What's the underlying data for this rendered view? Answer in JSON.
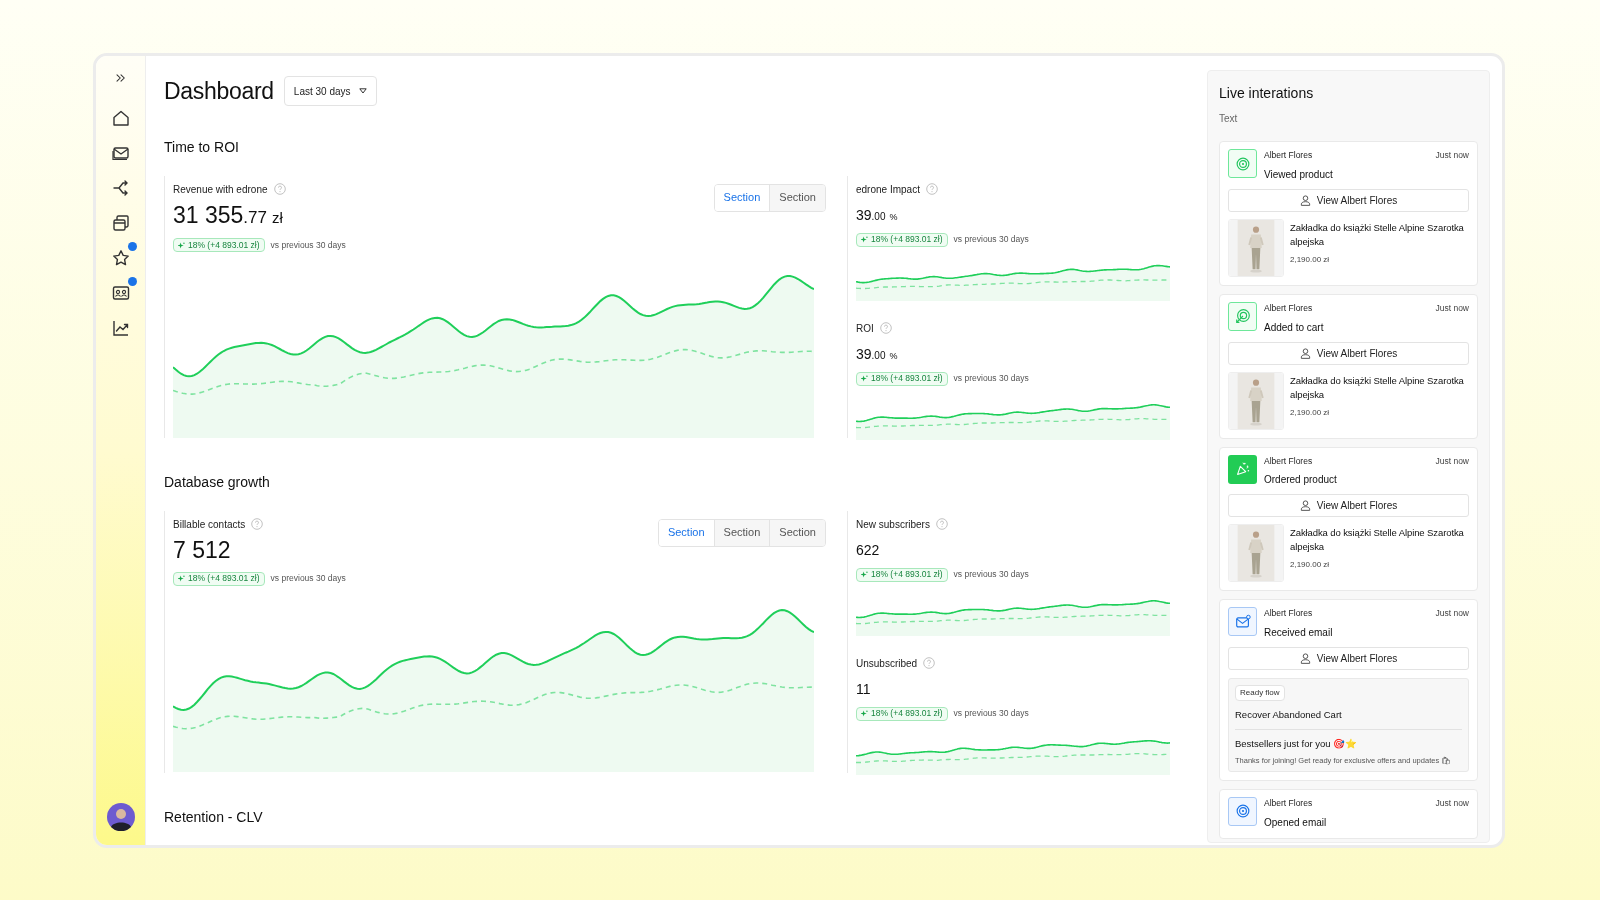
{
  "sidebar": {
    "items": [
      {
        "notification": false
      },
      {
        "notification": false
      },
      {
        "notification": false
      },
      {
        "notification": true
      },
      {
        "notification": true
      },
      {
        "notification": false
      }
    ]
  },
  "header": {
    "title": "Dashboard",
    "period": "Last 30 days"
  },
  "sections": [
    {
      "title": "Time to ROI",
      "main": {
        "label": "Revenue with edrone",
        "value": "31 355",
        "fraction": ".77",
        "unit": "zł",
        "change": "18% (+4 893.01 zł)",
        "comparison": "vs previous 30 days"
      },
      "tabs": [
        {
          "label": "Section",
          "selected": true
        },
        {
          "label": "Section",
          "selected": false
        }
      ],
      "side": [
        {
          "label": "edrone Impact",
          "value": "39",
          "fraction": ".00",
          "unit": "%",
          "change": "18% (+4 893.01 zł)",
          "comparison": "vs previous 30 days"
        },
        {
          "label": "ROI",
          "value": "39",
          "fraction": ".00",
          "unit": "%",
          "change": "18% (+4 893.01 zł)",
          "comparison": "vs previous 30 days"
        }
      ]
    },
    {
      "title": "Database growth",
      "main": {
        "label": "Billable contacts",
        "value": "7 512",
        "change": "18% (+4 893.01 zł)",
        "comparison": "vs previous 30 days"
      },
      "tabs": [
        {
          "label": "Section",
          "selected": true
        },
        {
          "label": "Section",
          "selected": false
        },
        {
          "label": "Section",
          "selected": false
        }
      ],
      "side": [
        {
          "label": "New subscribers",
          "value": "622",
          "change": "18% (+4 893.01 zł)",
          "comparison": "vs previous 30 days"
        },
        {
          "label": "Unsubscribed",
          "value": "11",
          "change": "18% (+4 893.01 zł)",
          "comparison": "vs previous 30 days"
        }
      ]
    },
    {
      "title": "Retention - CLV"
    }
  ],
  "live": {
    "title": "Live interations",
    "subtitle": "Text",
    "events": [
      {
        "kind": "viewed",
        "name": "Albert Flores",
        "time": "Just now",
        "action": "Viewed product",
        "button": "View Albert Flores",
        "product": {
          "title": "Zakładka do książki Stelle Alpine Szarotka alpejska",
          "price": "2,190.00 zł"
        }
      },
      {
        "kind": "cart",
        "name": "Albert Flores",
        "time": "Just now",
        "action": "Added to cart",
        "button": "View Albert Flores",
        "product": {
          "title": "Zakładka do książki Stelle Alpine Szarotka alpejska",
          "price": "2,190.00 zł"
        }
      },
      {
        "kind": "ordered",
        "name": "Albert Flores",
        "time": "Just now",
        "action": "Ordered product",
        "button": "View Albert Flores",
        "product": {
          "title": "Zakładka do książki Stelle Alpine Szarotka alpejska",
          "price": "2,190.00 zł"
        }
      },
      {
        "kind": "email",
        "name": "Albert Flores",
        "time": "Just now",
        "action": "Received email",
        "button": "View Albert Flores",
        "flow": {
          "badge": "Ready flow",
          "title": "Recover Abandoned Cart",
          "subject": "Bestsellers just for you 🎯⭐",
          "preview": "Thanks for joining! Get ready for exclusive offers and updates 🛍"
        }
      },
      {
        "kind": "opened",
        "name": "Albert Flores",
        "time": "Just now",
        "action": "Opened email"
      }
    ]
  }
}
